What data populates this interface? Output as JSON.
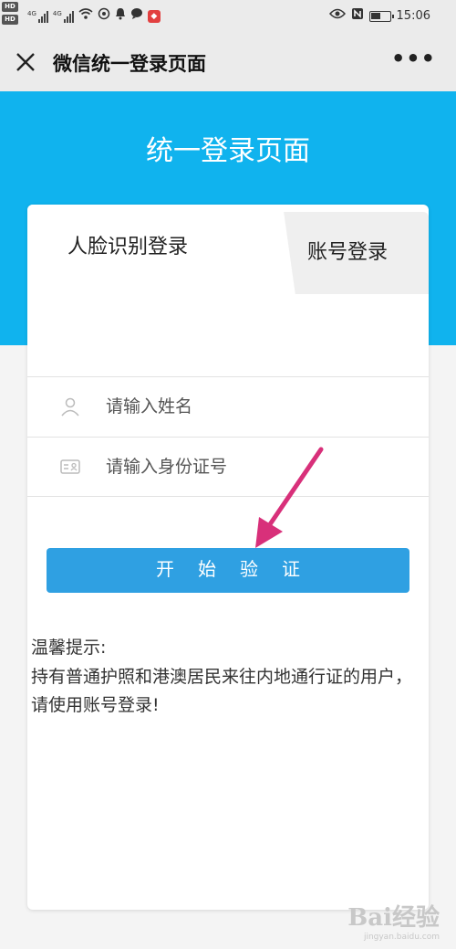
{
  "status_bar": {
    "network_left": "4G",
    "network_right": "4G",
    "time": "15:06"
  },
  "nav": {
    "close_icon": "close-icon",
    "title": "微信统一登录页面",
    "more": "•••"
  },
  "header": {
    "title": "统一登录页面"
  },
  "tabs": [
    {
      "label": "人脸识别登录",
      "active": true
    },
    {
      "label": "账号登录",
      "active": false
    }
  ],
  "form": {
    "name_placeholder": "请输入姓名",
    "id_placeholder": "请输入身份证号",
    "submit_label": "开始验证"
  },
  "tips": {
    "title": "温馨提示:",
    "text": "持有普通护照和港澳居民来往内地通行证的用户，请使用账号登录!"
  },
  "watermark": {
    "main": "Bai经验",
    "sub": "jingyan.baidu.com"
  },
  "colors": {
    "header_blue": "#10b3ee",
    "button_blue": "#2fa0e2",
    "arrow_pink": "#d8307a"
  }
}
